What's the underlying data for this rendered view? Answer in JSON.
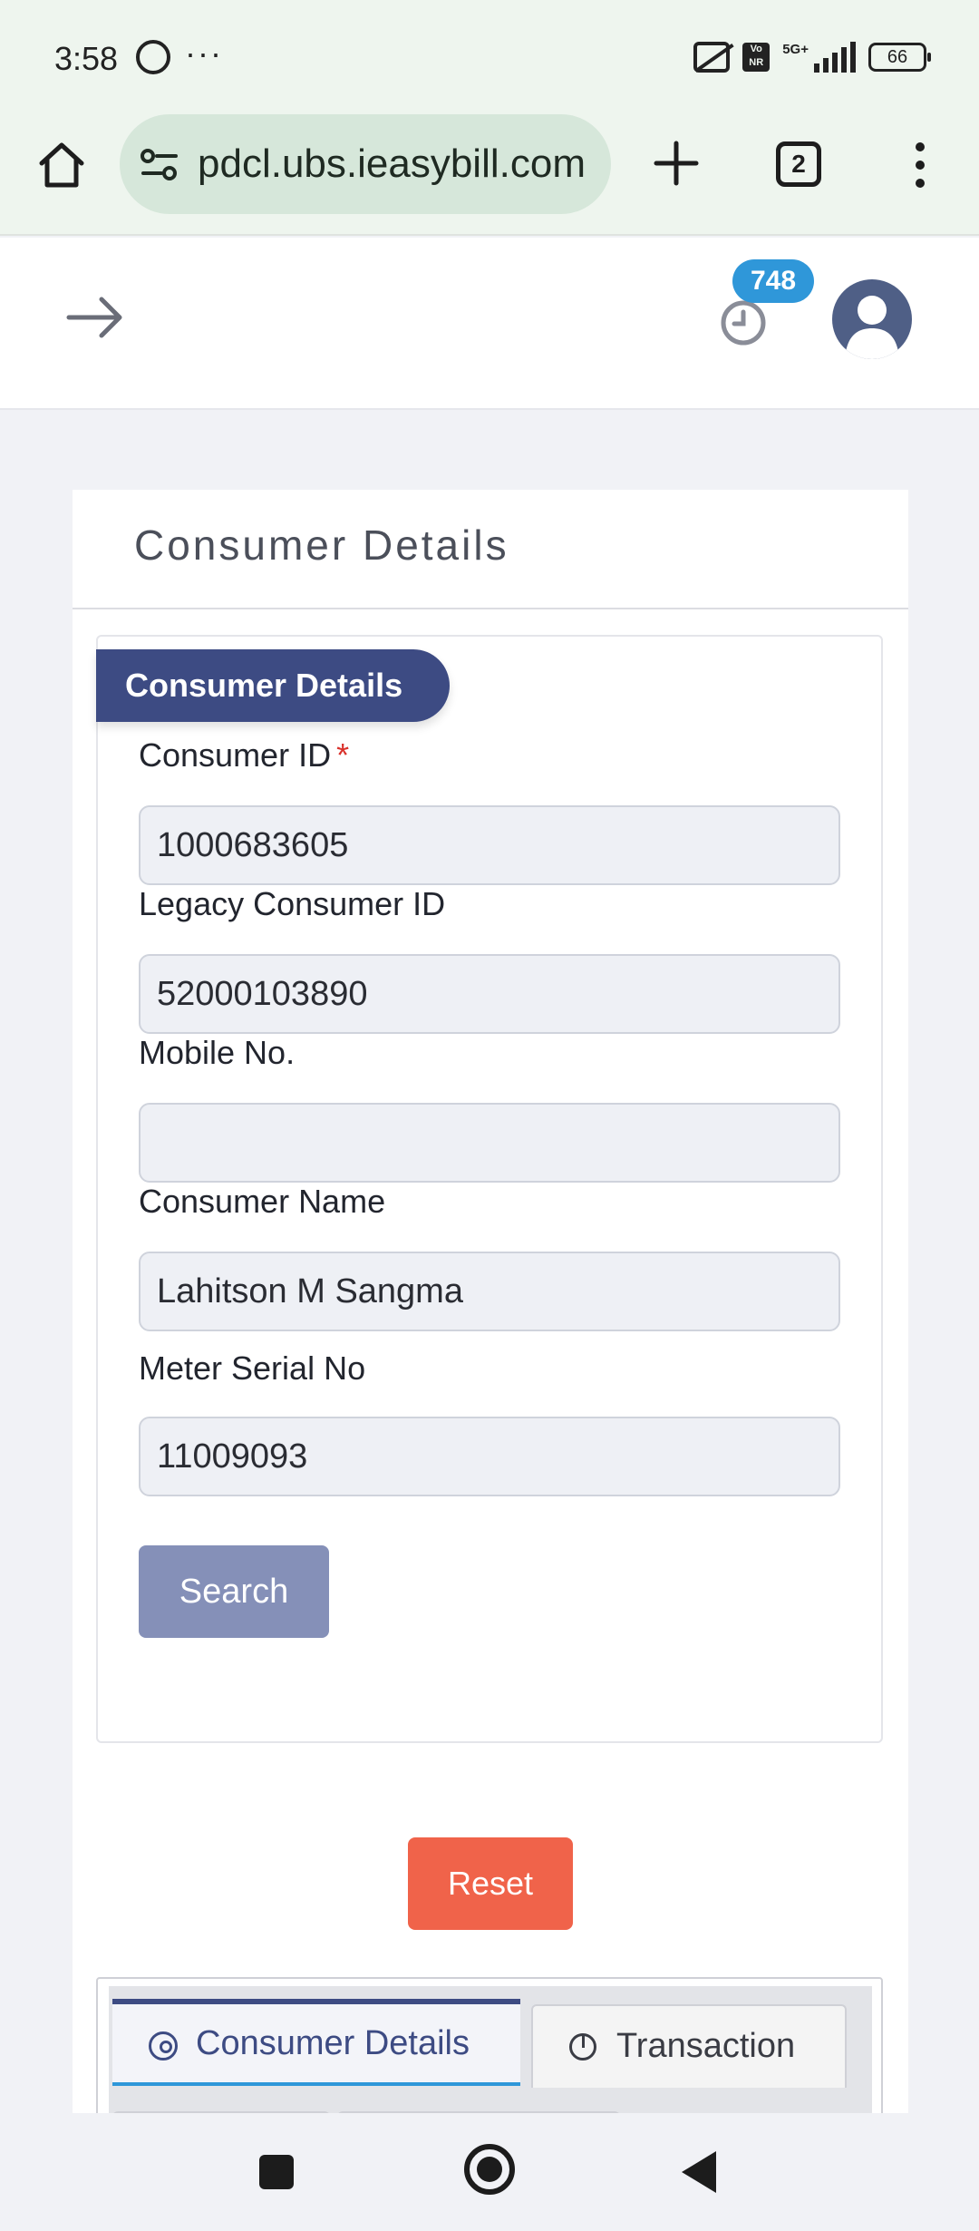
{
  "status_bar": {
    "time": "3:58",
    "network": "5G+",
    "volte": "Vo NR",
    "battery": "66"
  },
  "browser": {
    "url": "pdcl.ubs.ieasybill.com",
    "tab_count": "2"
  },
  "header": {
    "notification_count": "748"
  },
  "page": {
    "title": "Consumer Details",
    "section_legend": "Consumer Details"
  },
  "form": {
    "consumer_id": {
      "label": "Consumer ID",
      "required_mark": "*",
      "value": "1000683605"
    },
    "legacy_consumer_id": {
      "label": "Legacy Consumer ID",
      "value": "52000103890"
    },
    "mobile_no": {
      "label": "Mobile No.",
      "value": ""
    },
    "consumer_name": {
      "label": "Consumer Name",
      "value": "Lahitson M Sangma"
    },
    "meter_serial_no": {
      "label": "Meter Serial No",
      "value": "11009093"
    },
    "search_label": "Search",
    "reset_label": "Reset"
  },
  "tabs": [
    {
      "label": "Consumer Details",
      "active": true,
      "icon": "target-icon"
    },
    {
      "label": "Transaction",
      "active": false,
      "icon": "pie-chart-icon"
    }
  ],
  "colors": {
    "primary": "#3d4b83",
    "badge": "#2f97d9",
    "search_button": "#8590b8",
    "reset_button": "#f0634a",
    "required": "#d9312b"
  }
}
